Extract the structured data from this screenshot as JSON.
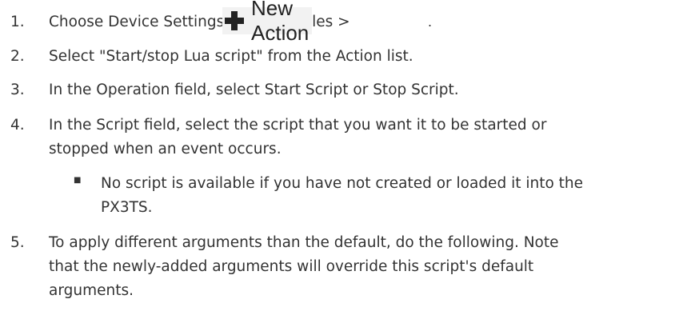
{
  "steps": [
    {
      "number": "1.",
      "text": "Choose Device Settings > Event Rules >",
      "button_label": "New Action",
      "button_icon": "plus-icon",
      "trailing": "."
    },
    {
      "number": "2.",
      "text": "Select \"Start/stop Lua script\" from the Action list."
    },
    {
      "number": "3.",
      "text": "In the Operation field, select Start Script or Stop Script."
    },
    {
      "number": "4.",
      "lines": [
        "In the Script field, select the script that you want it to be started or",
        "stopped when an event occurs."
      ]
    },
    {
      "bullet_mark": "■",
      "bullet_lines": [
        "No script is available if you have not created or loaded it into the",
        "PX3TS."
      ]
    },
    {
      "number": "5.",
      "lines": [
        "To apply different arguments than the default, do the following. Note",
        "that the newly-added arguments will override this script's default",
        "arguments."
      ]
    }
  ],
  "colors": {
    "text": "#333333",
    "button_bg": "#f2f2f2",
    "icon": "#222222"
  }
}
